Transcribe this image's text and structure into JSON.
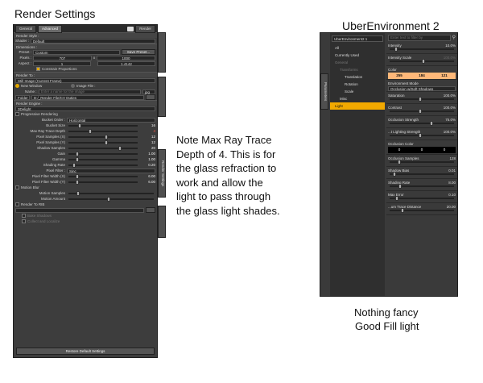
{
  "render_settings": {
    "heading": "Render Settings",
    "tabs": [
      "General",
      "Advanced"
    ],
    "render_button": "Render",
    "render_style_label": "Render Style :",
    "shader_label": "Shader :",
    "shader_value": "Default",
    "dimensions_label": "Dimensions :",
    "preset_label": "Preset :",
    "preset_value": "Custom",
    "save_preset": "Save Preset...",
    "pixels_label": "Pixels :",
    "pixels_w": "707",
    "pixels_x": "x",
    "pixels_h": "1000",
    "aspect_label": "Aspect :",
    "aspect_w": "1",
    "aspect_h": "1.4142",
    "constrain": "Constrain Proportions",
    "render_to_label": "Render To :",
    "render_to_value": "Still Image (Current Frame)",
    "new_window": "New Window",
    "image_file": "Image File :",
    "name_label": "Name :",
    "name_placeholder": "Enter a name for the image",
    "format": "jpg",
    "folder_label": "Folder",
    "folder_value": "D:/_Render File/CV Duties",
    "render_engine_label": "Render Engine :",
    "engine_value": "3Delight",
    "progressive": "Progressive Rendering",
    "bucket_order_label": "Bucket Order :",
    "bucket_order_value": "Horizontal",
    "params": [
      {
        "label": "Bucket Size",
        "value": "16",
        "pos": 0.15,
        "red": false
      },
      {
        "label": "Max Ray Trace Depth",
        "value": "4",
        "pos": 0.32,
        "red": true
      },
      {
        "label": "Pixel Samples (X)",
        "value": "12",
        "pos": 0.58,
        "red": false
      },
      {
        "label": "Pixel Samples (Y)",
        "value": "12",
        "pos": 0.58,
        "red": false
      },
      {
        "label": "Shadow Samples",
        "value": "20",
        "pos": 0.8,
        "red": false
      },
      {
        "label": "Gain",
        "value": "1.00",
        "pos": 0.12,
        "red": false
      },
      {
        "label": "Gamma",
        "value": "1.00",
        "pos": 0.12,
        "red": false
      },
      {
        "label": "Shading Rate",
        "value": "0.20",
        "pos": 0.07,
        "red": false
      }
    ],
    "pixel_filter_label": "Pixel Filter :",
    "pixel_filter_value": "Sinc",
    "filter_params": [
      {
        "label": "Pixel Filter Width (X)",
        "value": "6.00",
        "pos": 0.12
      },
      {
        "label": "Pixel Filter Width (Y)",
        "value": "6.00",
        "pos": 0.12
      }
    ],
    "motion_blur": "Motion Blur",
    "motion_params": [
      {
        "label": "Motion Samples",
        "pos": 0.1
      },
      {
        "label": "Motion Amount",
        "pos": 0.5
      }
    ],
    "render_to_rib": "Render To RIB",
    "rib_options": [
      "Bake Shadows",
      "Collect and Localize"
    ],
    "restore_defaults": "Restore Default Settings",
    "side_tab": "Render Settings"
  },
  "uber": {
    "heading": "UberEnvironment 2",
    "dropdown": "UberEnvironment2 1",
    "filter_placeholder": "Enter text to filter by",
    "side_tab": "Parameters",
    "tree": [
      {
        "label": "All",
        "sel": false
      },
      {
        "label": "Currently Used",
        "sel": false
      },
      {
        "label": "General",
        "sel": false
      },
      {
        "label": "Transforms",
        "sel": false
      },
      {
        "label": "Translation",
        "sel": false
      },
      {
        "label": "Rotation",
        "sel": false
      },
      {
        "label": "Scale",
        "sel": false
      },
      {
        "label": "Misc",
        "sel": false
      },
      {
        "label": "Light",
        "sel": true
      }
    ],
    "intensity_label": "Intensity",
    "intensity_value": "10.0%",
    "intensity_scale_label": "Intensity Scale",
    "intensity_scale_value": "100.0%",
    "color_label": "Color",
    "color_r": "255",
    "color_g": "184",
    "color_b": "121",
    "color_hex": "#ffb879",
    "env_mode_label": "Environment Mode",
    "env_mode_value": "Occlusion w/Soft Shadows",
    "props": [
      {
        "label": "Saturation",
        "value": "100.0%",
        "pos": 0.5
      },
      {
        "label": "Contrast",
        "value": "100.0%",
        "pos": 0.5
      },
      {
        "label": "Occlusion Strength",
        "value": "75.0%",
        "pos": 0.7
      },
      {
        "label": "...t Lighting Strength",
        "value": "100.0%",
        "pos": 0.5
      }
    ],
    "occ_color_label": "Occlusion Color",
    "occ_color": [
      "0",
      "0",
      "0"
    ],
    "occ_samples_label": "Occlusion Samples",
    "occ_samples_value": "128",
    "props2": [
      {
        "label": "Shadow Bias",
        "value": "0.01",
        "pos": 0.05
      },
      {
        "label": "Shading Rate",
        "value": "8.00",
        "pos": 0.15
      },
      {
        "label": "Max Error",
        "value": "0.10",
        "pos": 0.1
      },
      {
        "label": "...um Trace Distance",
        "value": "20.00",
        "pos": 0.2
      }
    ]
  },
  "notes": {
    "left_note": "Note Max Ray Trace Depth of 4. This is for the glass refraction to work and allow the light to pass through the glass light shades.",
    "right_note_line1": "Nothing fancy",
    "right_note_line2": "Good Fill light"
  }
}
